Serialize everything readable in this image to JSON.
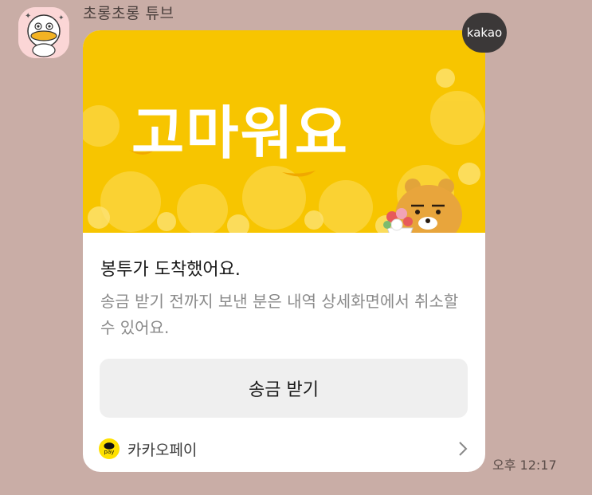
{
  "chat": {
    "sender_name": "초롱초롱 튜브",
    "timestamp": "오후 12:17"
  },
  "card": {
    "badge": "kakao",
    "banner_title": "고마워요",
    "headline": "봉투가 도착했어요.",
    "description": "송금 받기 전까지 보낸 분은 내역 상세화면에서 취소할 수 있어요.",
    "action_label": "송금 받기",
    "footer_label": "카카오페이",
    "pay_icon_text": "pay"
  },
  "colors": {
    "background": "#c9ada6",
    "banner_yellow": "#f7c500",
    "button_gray": "#efefef",
    "pay_yellow": "#ffe100"
  }
}
